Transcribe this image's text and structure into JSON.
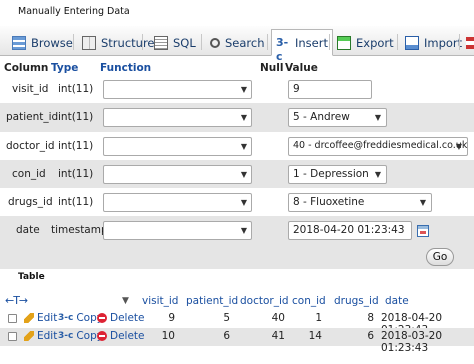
{
  "heading": "Manually Entering Data",
  "tabs": [
    {
      "label": "Browse"
    },
    {
      "label": "Structure"
    },
    {
      "label": "SQL"
    },
    {
      "label": "Search"
    },
    {
      "label": "Insert"
    },
    {
      "label": "Export"
    },
    {
      "label": "Import"
    }
  ],
  "insert_form": {
    "headers": {
      "column": "Column",
      "type": "Type",
      "function": "Function",
      "null": "Null",
      "value": "Value"
    },
    "rows": [
      {
        "column": "visit_id",
        "type": "int(11)",
        "value": "9"
      },
      {
        "column": "patient_id",
        "type": "int(11)",
        "value": "5 - Andrew"
      },
      {
        "column": "doctor_id",
        "type": "int(11)",
        "value": "40 - drcoffee@freddiesmedical.co.uk"
      },
      {
        "column": "con_id",
        "type": "int(11)",
        "value": "1 - Depression"
      },
      {
        "column": "drugs_id",
        "type": "int(11)",
        "value": "8 - Fluoxetine"
      },
      {
        "column": "date",
        "type": "timestamp",
        "value": "2018-04-20 01:23:43"
      }
    ],
    "go_label": "Go"
  },
  "table_caption": "Table",
  "results": {
    "resize_glyph": "←T→",
    "columns": [
      "visit_id",
      "patient_id",
      "doctor_id",
      "con_id",
      "drugs_id",
      "date"
    ],
    "actions": {
      "edit": "Edit",
      "copy": "Copy",
      "delete": "Delete"
    },
    "rows": [
      {
        "visit_id": "9",
        "patient_id": "5",
        "doctor_id": "40",
        "con_id": "1",
        "drugs_id": "8",
        "date": "2018-04-20 01:23:43"
      },
      {
        "visit_id": "10",
        "patient_id": "6",
        "doctor_id": "41",
        "con_id": "14",
        "drugs_id": "6",
        "date": "2018-03-20 01:23:43"
      }
    ]
  },
  "colors": {
    "link": "#1a4fa0",
    "row_alt": "#e5e5e5"
  }
}
